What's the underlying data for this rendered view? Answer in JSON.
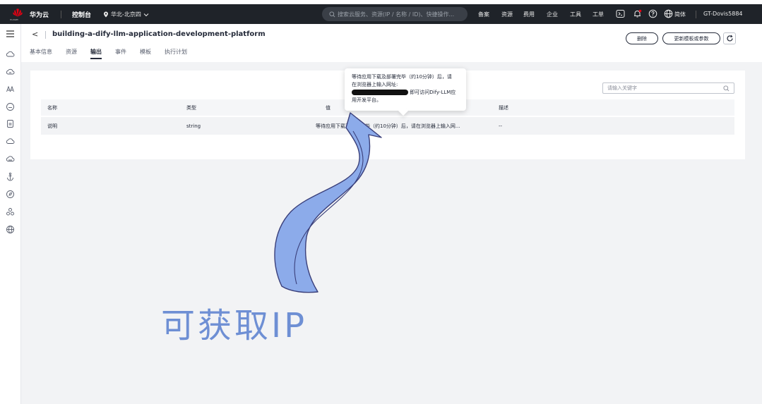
{
  "topbar": {
    "brand": "华为云",
    "logo_sub": "HUAWEI",
    "console": "控制台",
    "region": "华北-北京四",
    "search_placeholder": "搜索云服务、资源(IP / 名称 / ID)、快捷操作...",
    "nav": [
      "备案",
      "资源",
      "费用",
      "企业",
      "工具",
      "工单"
    ],
    "lang": "简体",
    "user": "GT-Dovis5884"
  },
  "header": {
    "back": "<",
    "title": "building-a-dify-llm-application-development-platform",
    "tabs": [
      "基本信息",
      "资源",
      "输出",
      "事件",
      "模板",
      "执行计划"
    ],
    "active_tab": "输出",
    "delete_btn": "删除",
    "update_btn": "更新模板或参数"
  },
  "filter": {
    "placeholder": "请输入关键字"
  },
  "table": {
    "columns": [
      "名称",
      "类型",
      "值",
      "描述"
    ],
    "rows": [
      {
        "name": "说明",
        "type": "string",
        "value": "等待应用下载及部署完毕（约10分钟）后，请在浏览器上输入网...",
        "desc": "--"
      }
    ]
  },
  "tooltip": {
    "line1": "等待应用下载及部署完毕（约10分钟）后，请",
    "line2": "在浏览器上输入网址:",
    "line3_suffix": "即可访问Dify-LLM应",
    "line4": "用开发平台。"
  },
  "annotation": {
    "text": "可获取IP",
    "color": "#6e8fd4"
  },
  "colors": {
    "topbar": "#1f2329",
    "accent": "#252b3a",
    "arrow_fill": "#8cabea",
    "arrow_stroke": "#3a3f7a"
  }
}
